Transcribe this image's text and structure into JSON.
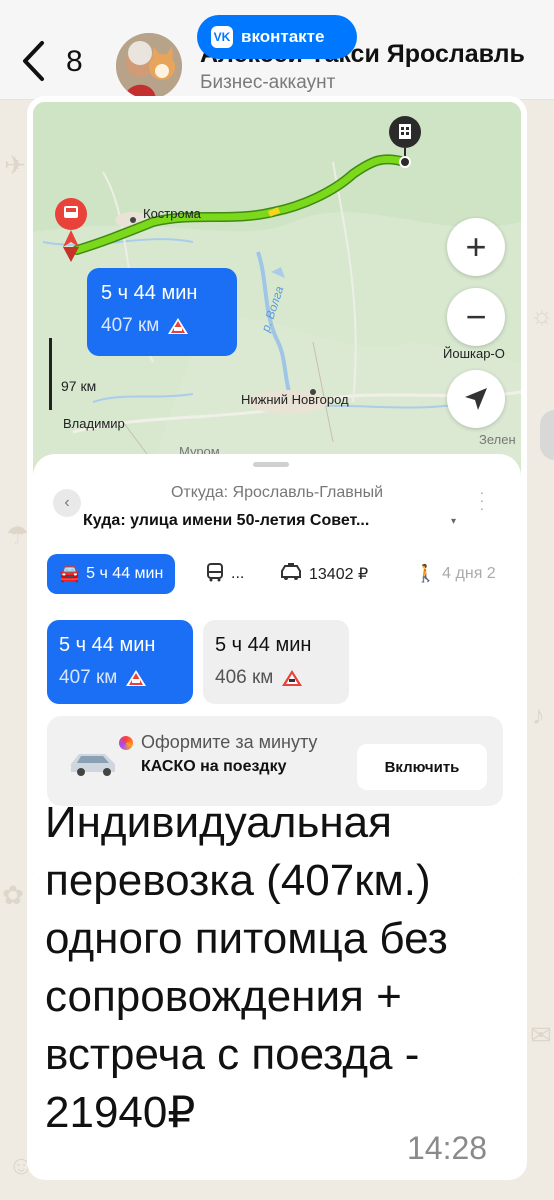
{
  "header": {
    "back_count": "8",
    "title": "Алексей Такси Ярославль",
    "subtitle": "Бизнес-аккаунт",
    "vk_badge": "VK",
    "vk_label": "вконтакте"
  },
  "map": {
    "cities": {
      "kostroma": "Кострома",
      "nizhny": "Нижний Новгород",
      "vladimir": "Владимир",
      "murom": "Муром",
      "yoshkar": "Йошкар-О",
      "zelen": "Зелен"
    },
    "river": "р. Волга",
    "scale": "97 км",
    "route_card": {
      "time": "5 ч 44 мин",
      "distance": "407 км"
    },
    "zoom_in": "+",
    "zoom_out": "−",
    "locate": "➤"
  },
  "sheet": {
    "from": "Откуда: Ярославль-Главный",
    "to": "Куда: улица имени 50-летия Совет...",
    "to_arrow": "▾",
    "modes": {
      "car": "5 ч 44 мин",
      "transit": "...",
      "taxi": "13402 ₽",
      "walk": "4 дня 2"
    },
    "options": [
      {
        "time": "5 ч 44 мин",
        "distance": "407 км"
      },
      {
        "time": "5 ч 44 мин",
        "distance": "406 км"
      }
    ],
    "promo": {
      "line1": "Оформите за минуту",
      "line2": "КАСКО на поездку",
      "button": "Включить"
    }
  },
  "message": {
    "text": "Индивидуальная перевозка (407км.) одного питомца без сопровождения + встреча с поезда - 21940₽",
    "time": "14:28"
  },
  "colors": {
    "accent_blue": "#1a6ff5",
    "vk_blue": "#0077ff",
    "route_green": "#7bd81a",
    "destination_dark": "#2b2b2b",
    "origin_red": "#e8423a"
  }
}
